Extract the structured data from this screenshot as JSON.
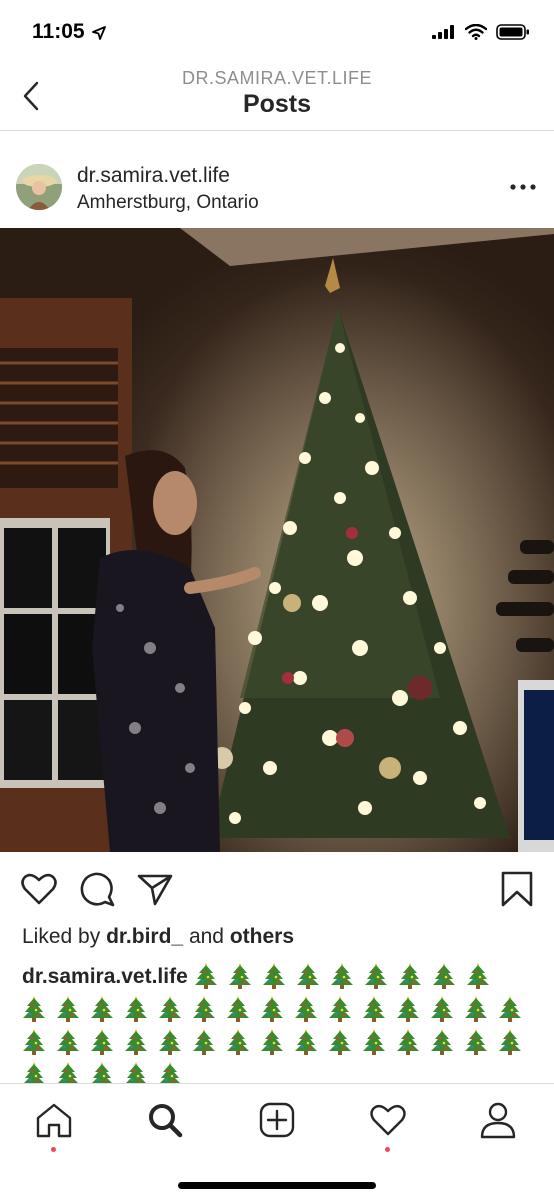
{
  "status_bar": {
    "time": "11:05",
    "icons": [
      "location-arrow-icon",
      "signal-icon",
      "wifi-icon",
      "battery-icon"
    ]
  },
  "header": {
    "account": "DR.SAMIRA.VET.LIFE",
    "title": "Posts",
    "back_icon": "chevron-left-icon"
  },
  "post": {
    "username": "dr.samira.vet.life",
    "location": "Amherstburg, Ontario",
    "more_icon": "more-dots-icon",
    "image_description": "christmas-tree-photo",
    "actions": [
      "heart-icon",
      "comment-icon",
      "share-icon",
      "bookmark-icon"
    ],
    "liked_prefix": "Liked by",
    "liked_by": "dr.bird_",
    "liked_and": "and",
    "liked_others": "others",
    "caption_user": "dr.samira.vet.life",
    "caption_emoji": "🎄",
    "caption_emoji_count": 44
  },
  "tab_bar": {
    "tabs": [
      {
        "icon": "home-icon",
        "notification_dot": true
      },
      {
        "icon": "search-icon",
        "notification_dot": false
      },
      {
        "icon": "add-post-icon",
        "notification_dot": false
      },
      {
        "icon": "heart-icon",
        "notification_dot": true
      },
      {
        "icon": "profile-icon",
        "notification_dot": false
      }
    ]
  },
  "colors": {
    "text": "#262626",
    "secondary": "#8e8e8e",
    "divider": "#dbdbdb",
    "notification_dot": "#ed4956"
  }
}
